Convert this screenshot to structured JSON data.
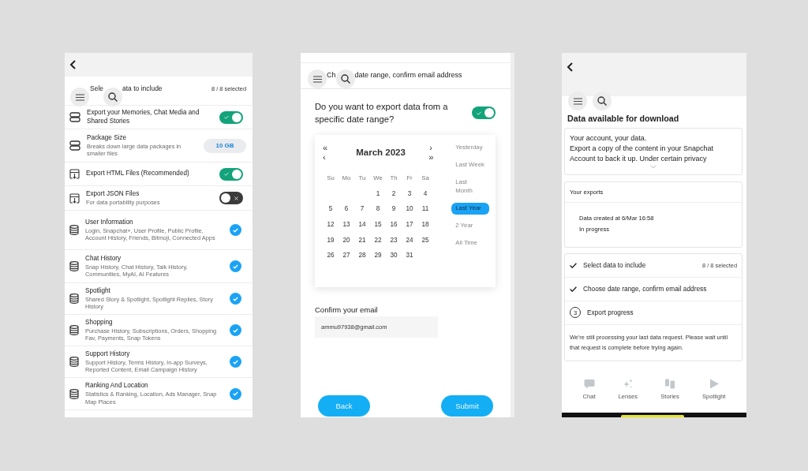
{
  "screens": [
    {
      "kind": "select",
      "title_parts": [
        "Sele",
        "ata to include"
      ],
      "count": "8 / 8 selected",
      "rows": [
        {
          "kind": "toggle",
          "title": "Export your Memories, Chat Media and Shared Stories",
          "on": true
        },
        {
          "kind": "size",
          "title": "Package Size",
          "subtitle": "Breaks down large data packages in smaller files",
          "value": "10 GB"
        },
        {
          "kind": "toggle",
          "title": "Export HTML Files (Recommended)",
          "on": true
        },
        {
          "kind": "toggle",
          "title": "Export JSON Files",
          "subtitle": "For data portability purposes",
          "on": false
        },
        {
          "kind": "check",
          "title": "User Information",
          "subtitle": "Login, Snapchat+, User Profile, Public Profile, Account History, Friends, Bitmoji, Connected Apps",
          "checked": true
        },
        {
          "kind": "check",
          "title": "Chat History",
          "subtitle": "Snap History, Chat History, Talk History, Communities, MyAI, AI Features",
          "checked": true
        },
        {
          "kind": "check",
          "title": "Spotlight",
          "subtitle": "Shared Story & Spotlight, Spotlight Replies, Story History",
          "checked": true
        },
        {
          "kind": "check",
          "title": "Shopping",
          "subtitle": "Purchase History, Subscriptions, Orders, Shopping Fav, Payments, Snap Tokens",
          "checked": true
        },
        {
          "kind": "check",
          "title": "Support History",
          "subtitle": "Support History, Terms History, In-app Surveys, Reported Content, Email Campaign History",
          "checked": true
        },
        {
          "kind": "check",
          "title": "Ranking And Location",
          "subtitle": "Statistics & Ranking, Location, Ads Manager, Snap Map Places",
          "checked": true
        }
      ]
    },
    {
      "kind": "date",
      "title_parts": [
        "Ch",
        "date range, confirm email address"
      ],
      "question": "Do you want to export data from a specific date range?",
      "date_range_on": true,
      "calendar": {
        "month": "March 2023",
        "nav": [
          "«",
          "›",
          "‹",
          "»"
        ],
        "weekdays": [
          "Su",
          "Mo",
          "Tu",
          "We",
          "Th",
          "Fr",
          "Sa"
        ],
        "days": [
          "1",
          "2",
          "3",
          "4",
          "5",
          "6",
          "7",
          "8",
          "9",
          "10",
          "11",
          "12",
          "13",
          "14",
          "15",
          "16",
          "17",
          "18",
          "19",
          "20",
          "21",
          "22",
          "23",
          "24",
          "25",
          "26",
          "27",
          "28",
          "29",
          "30",
          "31"
        ],
        "presets": [
          {
            "label": "Yesterday",
            "selected": false
          },
          {
            "label": "Last Week",
            "selected": false
          },
          {
            "label": "Last Month",
            "selected": false
          },
          {
            "label": "Last Year",
            "selected": true
          },
          {
            "label": "2 Year",
            "selected": false
          },
          {
            "label": "All Time",
            "selected": false
          }
        ]
      },
      "email_label": "Confirm your email",
      "email": "ammu97938@gmail.com",
      "buttons": [
        "Back",
        "Submit"
      ]
    },
    {
      "kind": "exports",
      "heading": "Data available for download",
      "intro": [
        "Your account, your data.",
        "Export a copy of the content in your Snapchat Account to back it up. Under certain privacy"
      ],
      "exports_title": "Your exports",
      "export": {
        "created": "Data created at 6/Mar 16:58",
        "status": "In progress"
      },
      "steps": [
        {
          "kind": "done",
          "label": "Select data to include",
          "count": "8 / 8 selected"
        },
        {
          "kind": "done",
          "label": "Choose date range, confirm email address"
        },
        {
          "kind": "pending",
          "number": "3",
          "label": "Export progress"
        }
      ],
      "notice": "We're still processing your last data request. Please wait until that request is complete before trying again.",
      "tabs": [
        {
          "label": "Chat"
        },
        {
          "label": "Lenses"
        },
        {
          "label": "Stories"
        },
        {
          "label": "Spotlight"
        }
      ]
    }
  ]
}
